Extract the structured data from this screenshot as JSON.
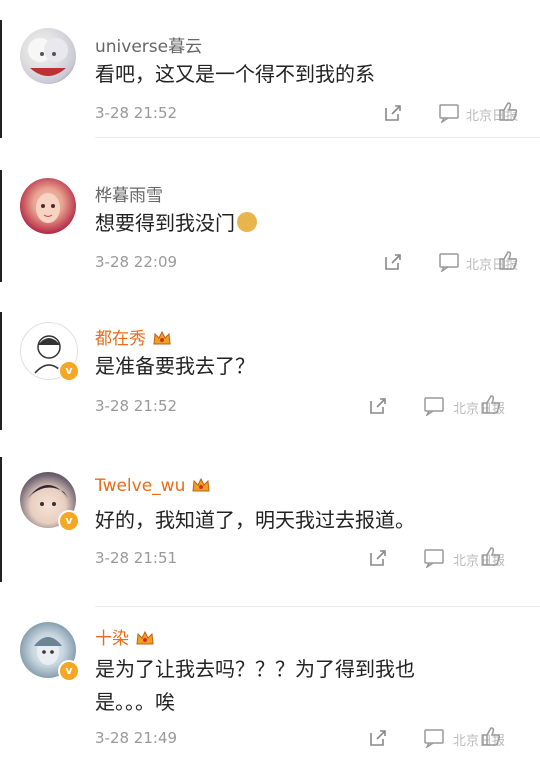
{
  "comments": [
    {
      "username": "universe暮云",
      "text": [
        "看吧，这又是一个得不到我的系"
      ],
      "time": "3-28 21:52",
      "watermark": "北京日报",
      "vip": false,
      "verified": false,
      "emoji_icon": ""
    },
    {
      "username": "桦暮雨雪",
      "text": [
        "想要得到我没门"
      ],
      "time": "3-28 22:09",
      "watermark": "北京日报",
      "vip": false,
      "verified": false,
      "emoji_icon": "doge-emoji-icon"
    },
    {
      "username": "都在秀",
      "text": [
        "是准备要我去了？"
      ],
      "time": "3-28 21:52",
      "watermark": "北京日报",
      "vip": true,
      "verified": true,
      "emoji_icon": ""
    },
    {
      "username": "Twelve_wu",
      "text": [
        "好的，我知道了，明天我过去报道。"
      ],
      "time": "3-28 21:51",
      "watermark": "北京日报",
      "vip": true,
      "verified": true,
      "emoji_icon": ""
    },
    {
      "username": "十染",
      "text": [
        "是为了让我去吗？？？为了得到我也",
        "是。。。唉"
      ],
      "time": "3-28 21:49",
      "watermark": "北京日报",
      "vip": true,
      "verified": true,
      "emoji_icon": ""
    }
  ],
  "colors": {
    "vip_name": "#e86c1a",
    "normal_name": "#666666",
    "verified_badge": "#f5a623",
    "meta": "#999999"
  }
}
